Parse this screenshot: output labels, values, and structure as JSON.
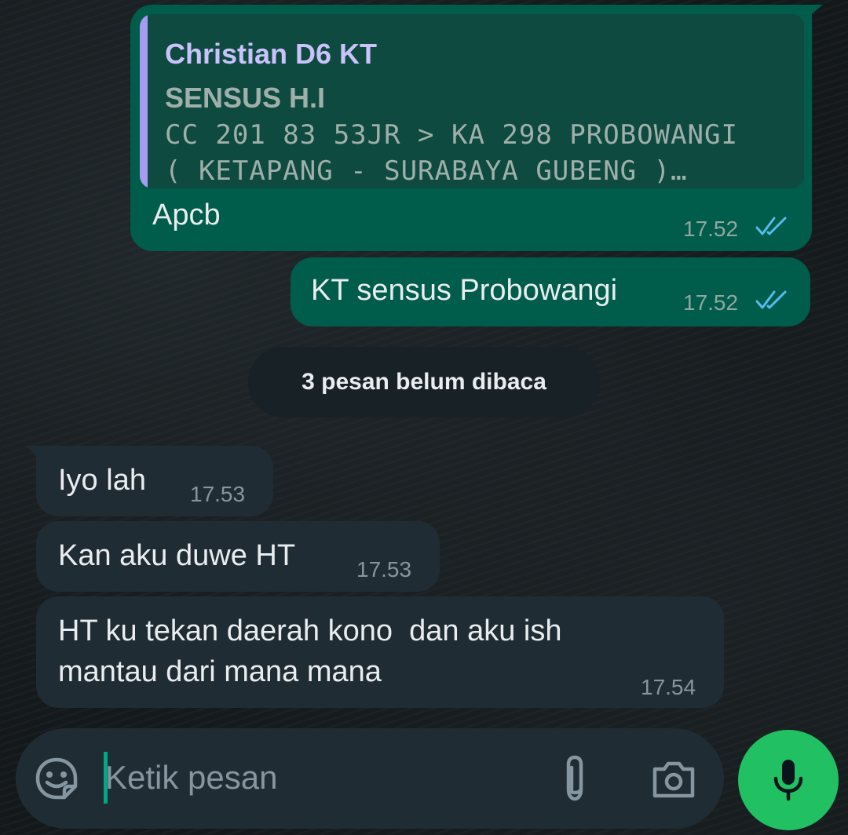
{
  "colors": {
    "outgoing_bubble": "#005c4b",
    "incoming_bubble": "#202c33",
    "quote_bar": "#a59bf0",
    "read_ticks": "#53bdeb",
    "accent": "#21c063"
  },
  "messages": [
    {
      "direction": "outgoing",
      "quote": {
        "author": "Christian D6 KT",
        "line1": "SENSUS H.I",
        "line2": "CC 201 83 53JR > KA 298 PROBOWANGI",
        "line3": "( KETAPANG - SURABAYA GUBENG )…"
      },
      "text": "Apcb",
      "time": "17.52",
      "status": "read"
    },
    {
      "direction": "outgoing",
      "text": "KT sensus Probowangi",
      "time": "17.52",
      "status": "read"
    },
    {
      "direction": "incoming",
      "text": "Iyo lah",
      "time": "17.53"
    },
    {
      "direction": "incoming",
      "text": "Kan aku duwe HT",
      "time": "17.53"
    },
    {
      "direction": "incoming",
      "text": "HT ku tekan daerah kono  dan aku ish\nmantau dari mana mana",
      "time": "17.54"
    }
  ],
  "unread_banner": "3 pesan belum dibaca",
  "composer": {
    "placeholder": "Ketik pesan",
    "value": "",
    "icons": [
      "sticker-icon",
      "paperclip-icon",
      "camera-icon",
      "microphone-icon"
    ]
  }
}
